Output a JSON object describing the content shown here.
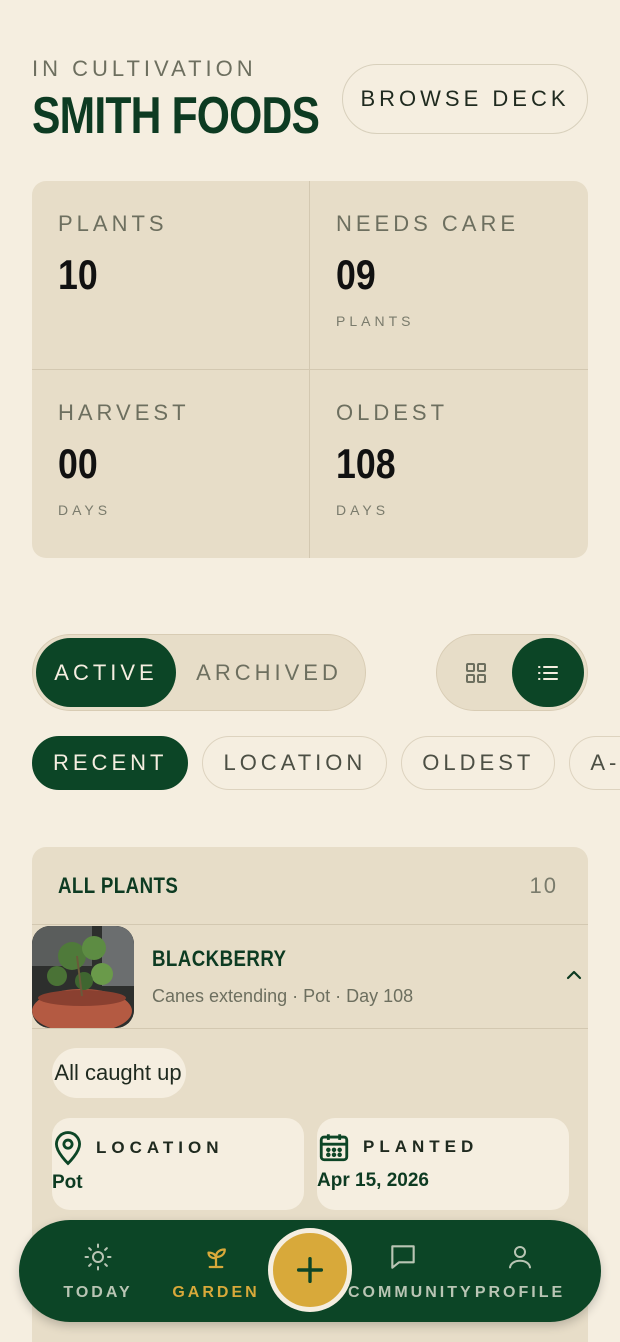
{
  "header": {
    "eyebrow": "IN CULTIVATION",
    "title": "SMITH FOODS",
    "browse_label": "BROWSE DECK"
  },
  "stats": [
    {
      "label": "PLANTS",
      "value": "10",
      "unit": ""
    },
    {
      "label": "NEEDS CARE",
      "value": "09",
      "unit": "PLANTS"
    },
    {
      "label": "HARVEST",
      "value": "00",
      "unit": "DAYS"
    },
    {
      "label": "OLDEST",
      "value": "108",
      "unit": "DAYS"
    }
  ],
  "status_toggle": {
    "active": "ACTIVE",
    "archived": "ARCHIVED"
  },
  "view_toggle": {
    "grid_icon": "grid-icon",
    "list_icon": "list-icon",
    "selected": "list"
  },
  "sort_chips": [
    "RECENT",
    "LOCATION",
    "OLDEST",
    "A-Z"
  ],
  "plants": {
    "title": "ALL PLANTS",
    "count": "10",
    "items": [
      {
        "name": "BLACKBERRY",
        "meta": "Canes extending · Pot · Day 108",
        "status": "All caught up",
        "location_label": "LOCATION",
        "location_value": "Pot",
        "planted_label": "PLANTED",
        "planted_value": "Apr 15, 2026"
      }
    ]
  },
  "nav": {
    "today": "TODAY",
    "garden": "GARDEN",
    "community": "COMMUNITY",
    "profile": "PROFILE"
  },
  "colors": {
    "primary": "#0c4526",
    "accent": "#d8a93a",
    "background": "#f5eee0",
    "card": "#e7ddc8"
  }
}
